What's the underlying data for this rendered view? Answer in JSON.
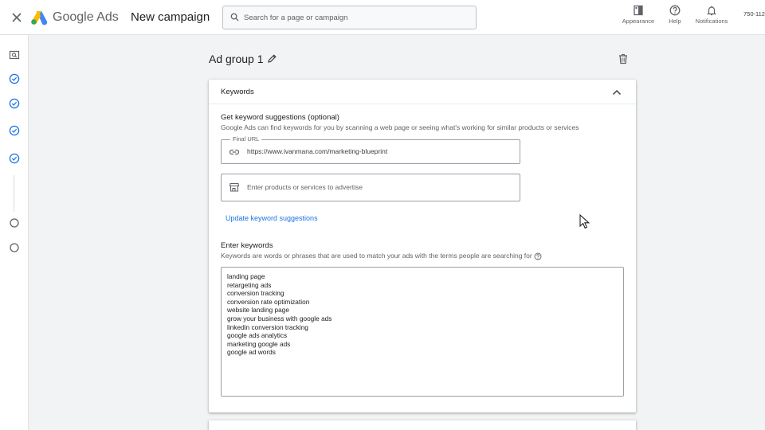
{
  "header": {
    "brand": "Google Ads",
    "title": "New campaign",
    "search_placeholder": "Search for a page or campaign",
    "appearance_label": "Appearance",
    "help_label": "Help",
    "notifications_label": "Notifications",
    "account_id": "750-112"
  },
  "ad_group": {
    "title": "Ad group 1"
  },
  "keywords_card": {
    "title": "Keywords",
    "suggestions": {
      "title": "Get keyword suggestions (optional)",
      "description": "Google Ads can find keywords for you by scanning a web page or seeing what's working for similar products or services",
      "final_url_label": "Final URL",
      "final_url_value": "https://www.ivanmana.com/marketing-blueprint",
      "products_placeholder": "Enter products or services to advertise",
      "update_link": "Update keyword suggestions"
    },
    "enter": {
      "title": "Enter keywords",
      "description": "Keywords are words or phrases that are used to match your ads with the terms people are searching for"
    },
    "keywords": [
      "landing page",
      "retargeting ads",
      "conversion tracking",
      "conversion rate optimization",
      "website landing page",
      "grow your business with google ads",
      "linkedin conversion tracking",
      "google ads analytics",
      "marketing google ads",
      "google ad words"
    ]
  },
  "colors": {
    "accent": "#1a73e8",
    "background": "#f1f3f4"
  }
}
